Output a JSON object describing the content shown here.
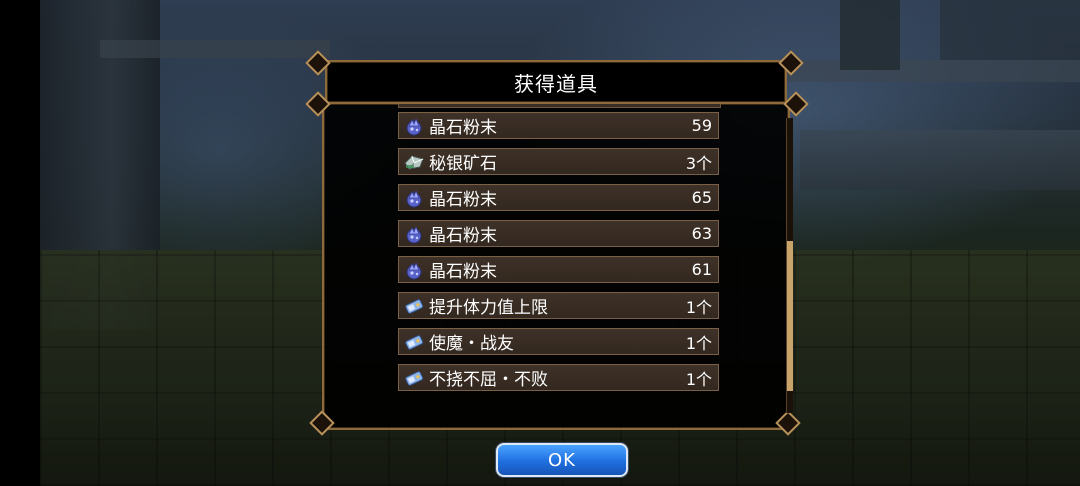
{
  "dialog": {
    "title": "获得道具",
    "ok_label": "OK",
    "scroll_position": 0.85
  },
  "items": [
    {
      "icon": "crystal-powder-icon",
      "name": "晶石粉末",
      "qty": "59"
    },
    {
      "icon": "mithril-ore-icon",
      "name": "秘银矿石",
      "qty": "3个"
    },
    {
      "icon": "crystal-powder-icon",
      "name": "晶石粉末",
      "qty": "65"
    },
    {
      "icon": "crystal-powder-icon",
      "name": "晶石粉末",
      "qty": "63"
    },
    {
      "icon": "crystal-powder-icon",
      "name": "晶石粉末",
      "qty": "61"
    },
    {
      "icon": "ticket-icon",
      "name": "提升体力值上限",
      "qty": "1个"
    },
    {
      "icon": "ticket-icon",
      "name": "使魔・战友",
      "qty": "1个"
    },
    {
      "icon": "ticket-icon",
      "name": "不挠不屈・不败",
      "qty": "1个"
    }
  ],
  "colors": {
    "frame": "#8c6a3c",
    "row_bg": "#3a2e24",
    "ok_button": "#1f6fe0"
  }
}
